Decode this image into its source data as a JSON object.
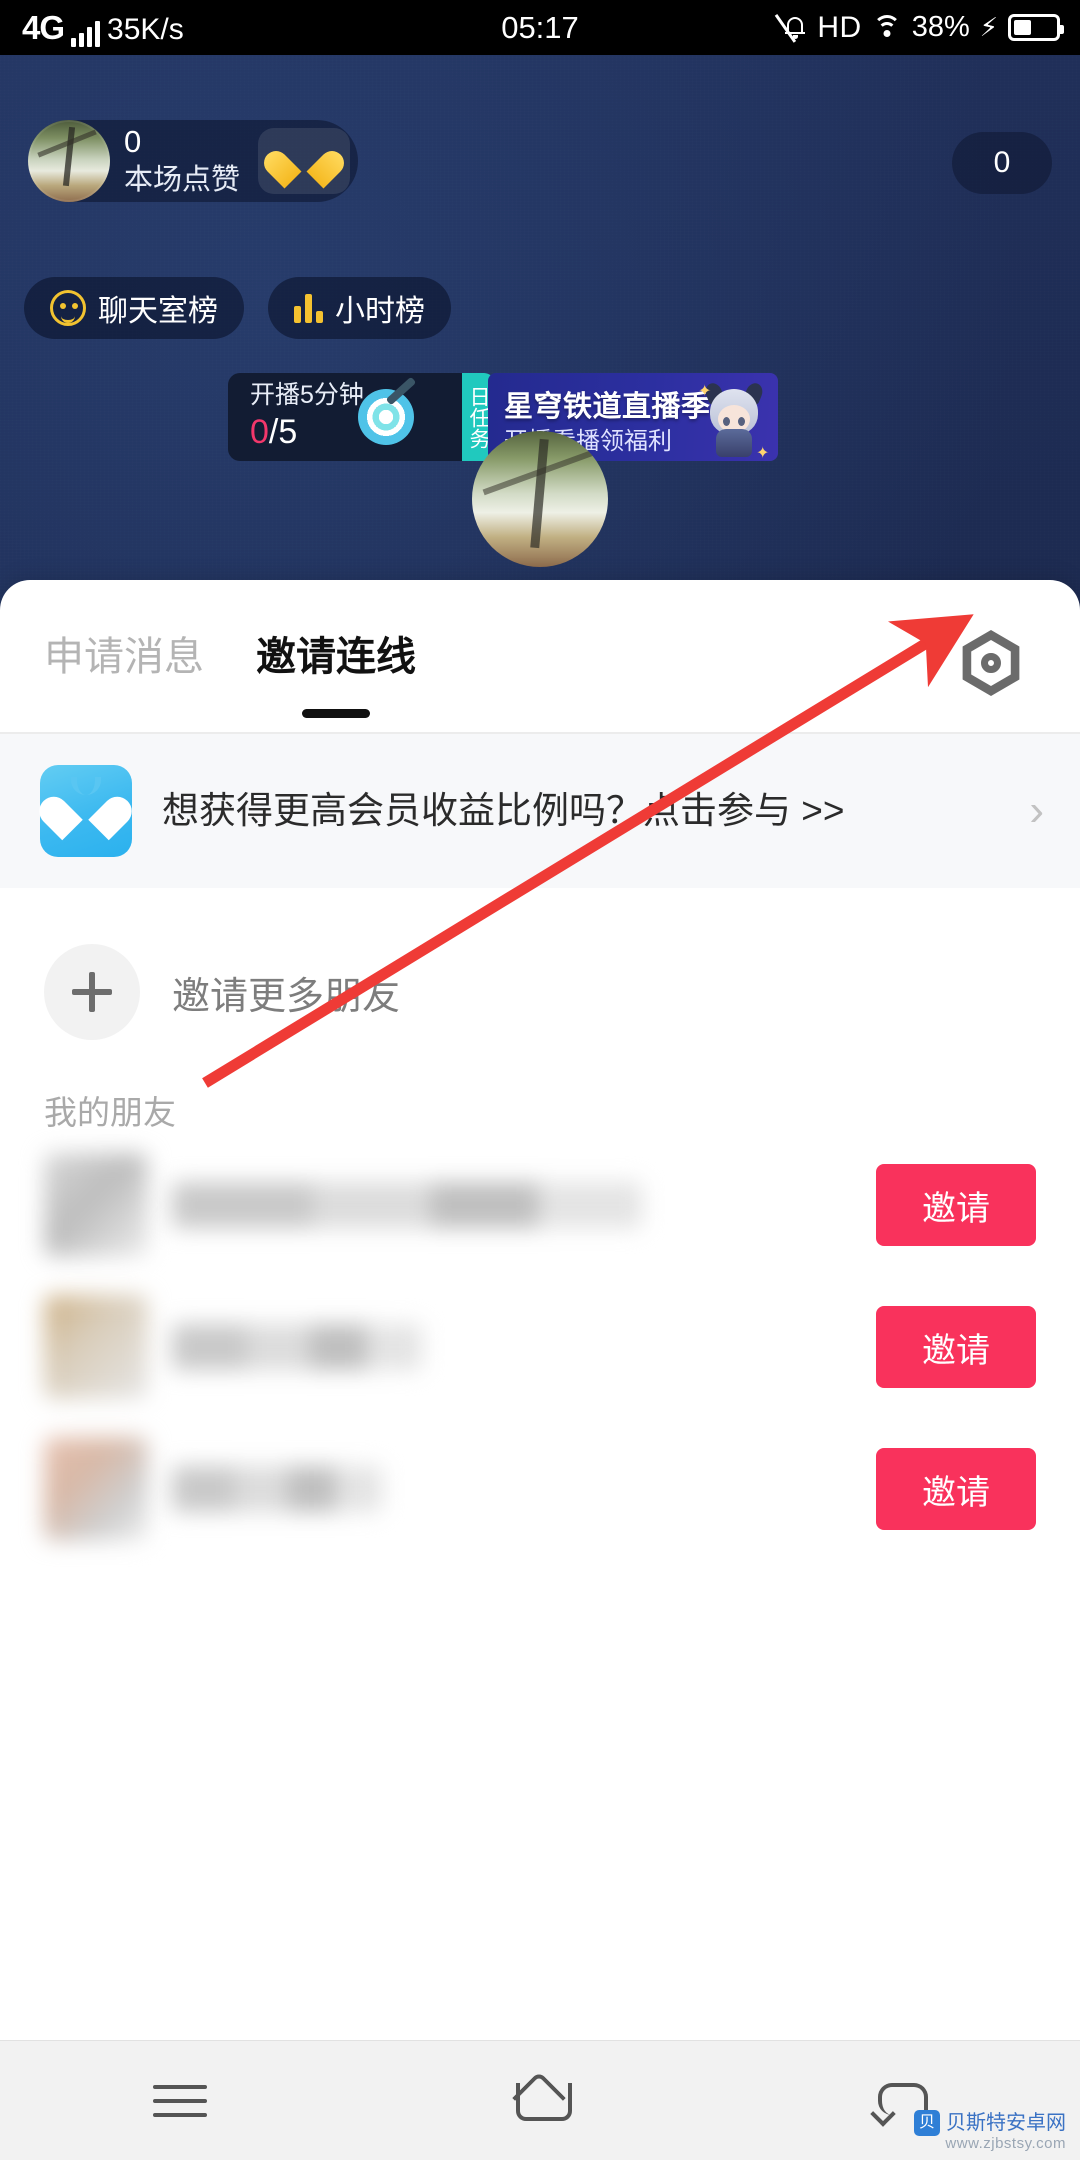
{
  "status_bar": {
    "network_type": "4G",
    "speed": "35K/s",
    "time": "05:17",
    "hd_label": "HD",
    "battery_percent": "38%",
    "icons": [
      "signal-bars-icon",
      "mute-bell-icon",
      "hd-icon",
      "wifi-icon",
      "charging-bolt-icon",
      "battery-icon"
    ]
  },
  "live": {
    "host_like_count": "0",
    "host_like_label": "本场点赞",
    "heart_icon": "yellow-heart-icon",
    "viewer_count": "0",
    "rank_buttons": [
      {
        "label": "聊天室榜",
        "icon": "chatroom-rank-icon"
      },
      {
        "label": "小时榜",
        "icon": "bar-chart-icon"
      }
    ],
    "task_card": {
      "title": "开播5分钟",
      "progress_current": "0",
      "progress_sep": "/",
      "progress_total": "5",
      "icon": "dart-target-icon",
      "tab_label": "日任务"
    },
    "game_banner": {
      "title": "星穹铁道直播季",
      "subtitle": "开播看播领福利",
      "character_icon": "anime-character-icon"
    }
  },
  "sheet": {
    "tabs": [
      {
        "label": "申请消息",
        "active": false
      },
      {
        "label": "邀请连线",
        "active": true
      }
    ],
    "settings_icon": "gear-hexagon-icon",
    "promo": {
      "icon": "blue-heart-app-icon",
      "text": "想获得更高会员收益比例吗？点击参与 >>",
      "chevron": "›"
    },
    "invite_more": {
      "icon": "plus-icon",
      "label": "邀请更多朋友"
    },
    "friends_section_title": "我的朋友",
    "friends": [
      {
        "name": "",
        "action_label": "邀请",
        "avatar": "blurred-avatar"
      },
      {
        "name": "",
        "action_label": "邀请",
        "avatar": "blurred-avatar"
      },
      {
        "name": "",
        "action_label": "邀请",
        "avatar": "blurred-avatar"
      }
    ],
    "invite_button_color": "#f9325c"
  },
  "annotation": {
    "arrow_color": "#ef3b36",
    "points_at": "gear-hexagon-icon"
  },
  "nav_bar": {
    "items": [
      "menu-icon",
      "home-icon",
      "back-icon"
    ]
  },
  "watermark": {
    "site_name": "贝斯特安卓网",
    "site_url": "www.zjbstsy.com"
  }
}
